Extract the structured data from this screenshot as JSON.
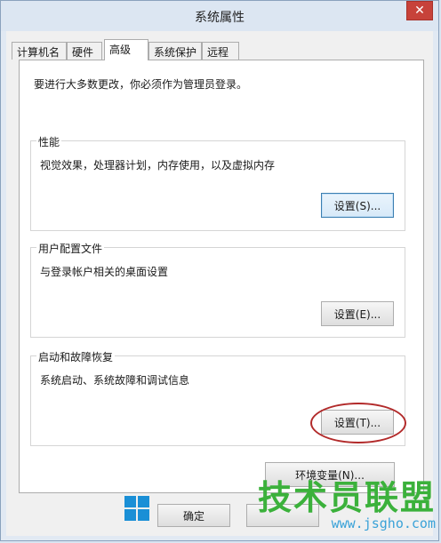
{
  "window": {
    "title": "系统属性",
    "close_label": "✕"
  },
  "tabs": [
    {
      "label": "计算机名",
      "active": false
    },
    {
      "label": "硬件",
      "active": false
    },
    {
      "label": "高级",
      "active": true
    },
    {
      "label": "系统保护",
      "active": false
    },
    {
      "label": "远程",
      "active": false
    }
  ],
  "advanced": {
    "note": "要进行大多数更改，你必须作为管理员登录。",
    "performance": {
      "title": "性能",
      "description": "视觉效果，处理器计划，内存使用，以及虚拟内存",
      "button": "设置(S)..."
    },
    "user_profiles": {
      "title": "用户配置文件",
      "description": "与登录帐户相关的桌面设置",
      "button": "设置(E)..."
    },
    "startup_recovery": {
      "title": "启动和故障恢复",
      "description": "系统启动、系统故障和调试信息",
      "button": "设置(T)..."
    },
    "env_button": "环境变量(N)..."
  },
  "footer": {
    "ok_label": "确定"
  },
  "watermark": {
    "main": "技术员联盟",
    "url": "www.jsgho.com"
  },
  "colors": {
    "annotation_circle": "#b22a2a",
    "watermark_green": "#3bb13b",
    "watermark_blue": "#3aa2d8"
  }
}
